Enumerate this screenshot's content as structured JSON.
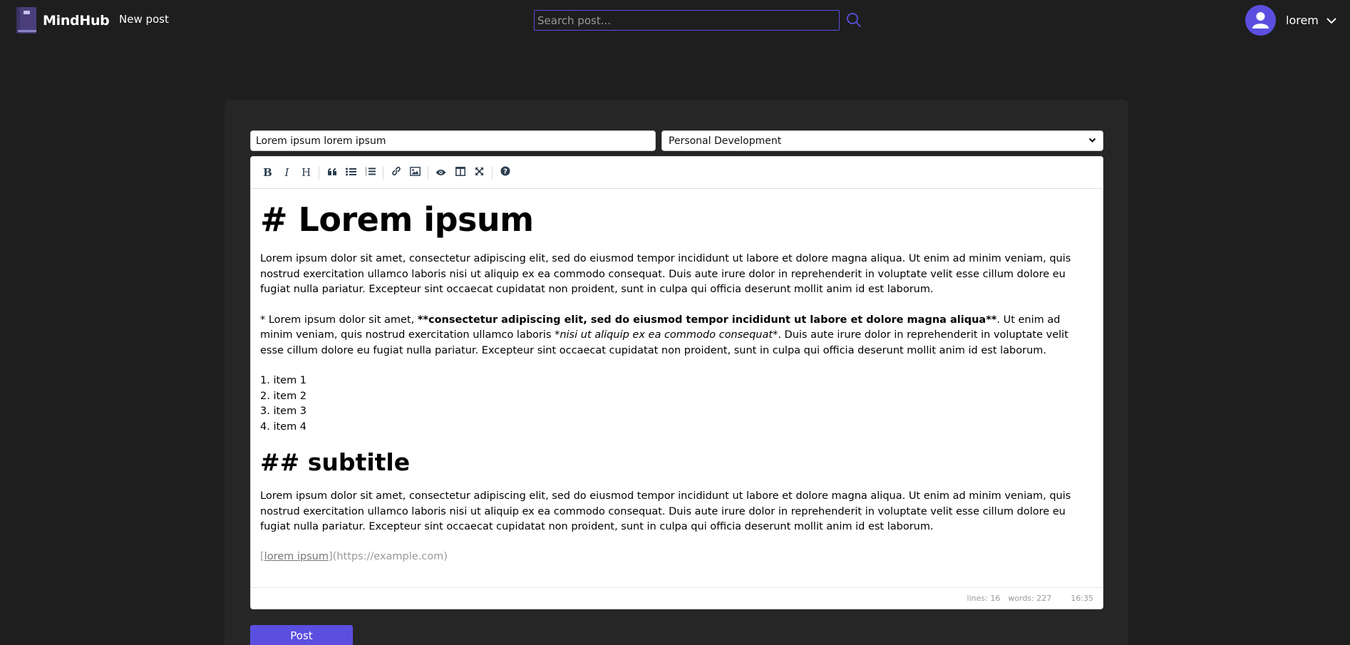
{
  "nav": {
    "brand": "MindHub",
    "new_post": "New post",
    "search_placeholder": "Search post...",
    "username": "lorem"
  },
  "colors": {
    "accent": "#5b4fe0",
    "background": "#1e1e1e",
    "card": "#262626"
  },
  "form": {
    "title_value": "Lorem ipsum lorem ipsum",
    "category_selected": "Personal Development",
    "post_button": "Post"
  },
  "toolbar": {
    "buttons": [
      "bold",
      "italic",
      "heading",
      "quote",
      "unordered-list",
      "ordered-list",
      "link",
      "image",
      "preview",
      "side-by-side",
      "fullscreen",
      "guide"
    ]
  },
  "editor": {
    "h1": "# Lorem ipsum",
    "p1": "Lorem ipsum dolor sit amet, consectetur adipiscing elit, sed do eiusmod tempor incididunt ut labore et dolore magna aliqua. Ut enim ad minim veniam, quis nostrud exercitation ullamco laboris nisi ut aliquip ex ea commodo consequat. Duis aute irure dolor in reprehenderit in voluptate velit esse cillum dolore eu fugiat nulla pariatur. Excepteur sint occaecat cupidatat non proident, sunt in culpa qui officia deserunt mollit anim id est laborum.",
    "p2_start": "* Lorem ipsum dolor sit amet, ",
    "p2_bold": "**consectetur adipiscing elit, sed do eiusmod tempor incididunt ut labore et dolore magna aliqua**",
    "p2_mid": ". Ut enim ad minim veniam, quis nostrud exercitation ullamco laboris ",
    "p2_italic": "*nisi ut aliquip ex ea commodo consequat*",
    "p2_end": ". Duis aute irure dolor in reprehenderit in voluptate velit esse cillum dolore eu fugiat nulla pariatur. Excepteur sint occaecat cupidatat non proident, sunt in culpa qui officia deserunt mollit anim id est laborum.",
    "list": [
      "1. item 1",
      "2. item 2",
      "3. item 3",
      "4. item 4"
    ],
    "h2": "## subtitle",
    "p3": "Lorem ipsum dolor sit amet, consectetur adipiscing elit, sed do eiusmod tempor incididunt ut labore et dolore magna aliqua. Ut enim ad minim veniam, quis nostrud exercitation ullamco laboris nisi ut aliquip ex ea commodo consequat. Duis aute irure dolor in reprehenderit in voluptate velit esse cillum dolore eu fugiat nulla pariatur. Excepteur sint occaecat cupidatat non proident, sunt in culpa qui officia deserunt mollit anim id est laborum.",
    "link_open": "[",
    "link_text": "lorem ipsum",
    "link_close": "]",
    "link_url": "(https://example.com)"
  },
  "status": {
    "lines": "lines: 16",
    "words": "words: 227",
    "time": "16:35"
  }
}
